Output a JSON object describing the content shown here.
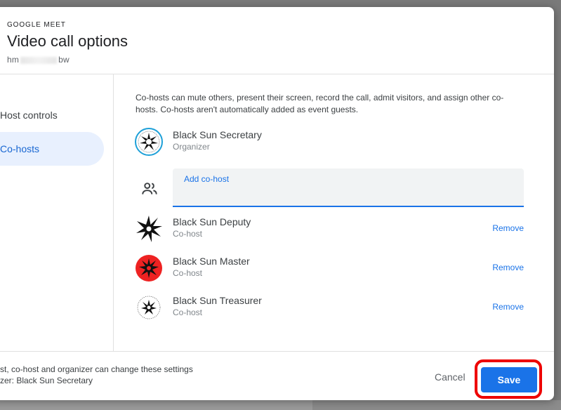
{
  "header": {
    "app_label": "GOOGLE MEET",
    "title": "Video call options",
    "code_start": "hm",
    "code_end": "bw"
  },
  "nav": {
    "items": [
      {
        "label": "Host controls"
      },
      {
        "label": "Co-hosts"
      }
    ]
  },
  "cohosts": {
    "description": "Co-hosts can mute others, present their screen, record the call, admit visitors, and assign other co-hosts. Co-hosts aren't automatically added as event guests.",
    "add_label": "Add co-host",
    "remove_label": "Remove",
    "people": [
      {
        "name": "Black Sun Secretary",
        "role": "Organizer"
      },
      {
        "name": "Black Sun Deputy",
        "role": "Co-host"
      },
      {
        "name": "Black Sun Master",
        "role": "Co-host"
      },
      {
        "name": "Black Sun Treasurer",
        "role": "Co-host"
      }
    ]
  },
  "footer": {
    "line1": "st, co-host and organizer can change these settings",
    "line2": "zer: Black Sun Secretary",
    "cancel": "Cancel",
    "save": "Save"
  },
  "colors": {
    "accent": "#1a73e8",
    "highlight": "#e00000"
  }
}
